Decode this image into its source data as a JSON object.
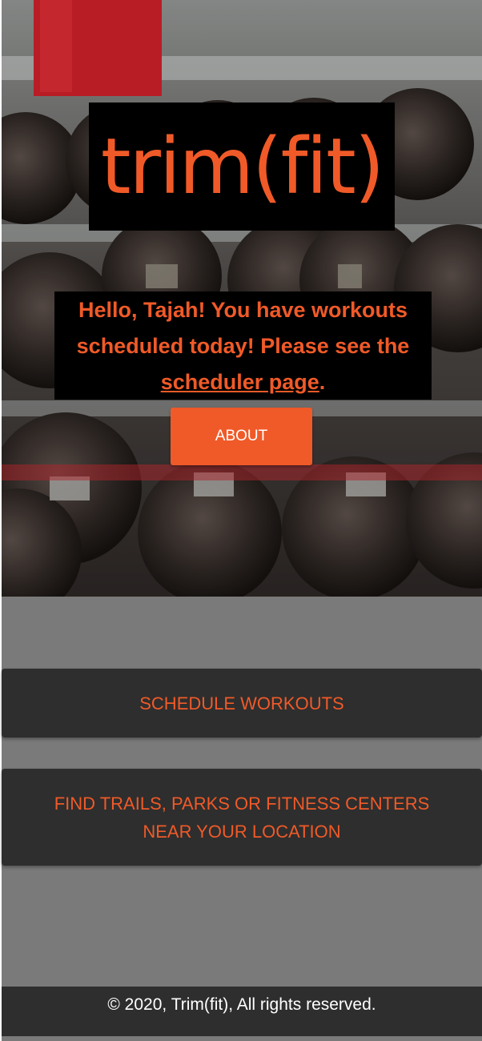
{
  "hero": {
    "logo_text": "trim(fit)",
    "greeting_prefix": "Hello, Tajah! You have workouts scheduled today! Please see the ",
    "greeting_link": "scheduler page",
    "greeting_suffix": ".",
    "about_button": "ABOUT"
  },
  "cards": {
    "schedule_label": "SCHEDULE WORKOUTS",
    "find_label": "FIND TRAILS, PARKS OR FITNESS CENTERS NEAR YOUR LOCATION"
  },
  "footer": {
    "copyright": "© 2020, Trim(fit), All rights reserved."
  },
  "colors": {
    "accent": "#f05a28",
    "card_bg": "#2e2e2e",
    "page_bg": "#7a7a7a"
  }
}
